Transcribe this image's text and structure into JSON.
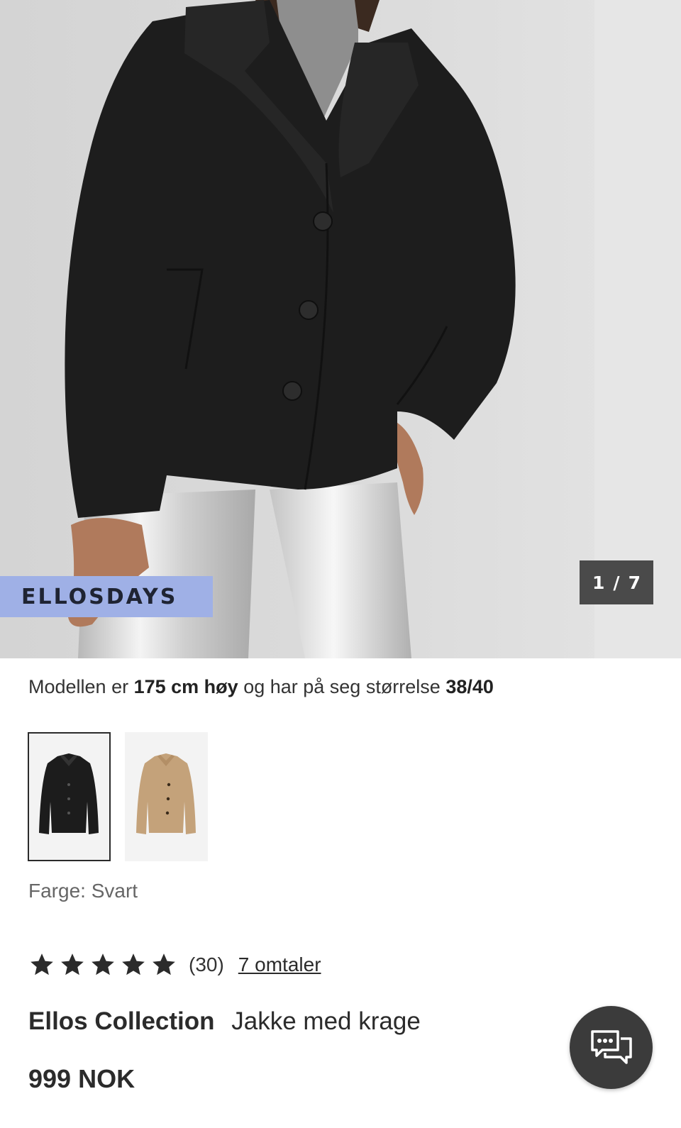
{
  "hero": {
    "badge": "ELLOSDAYS",
    "counter": {
      "current": "1",
      "separator": "/",
      "total": "7"
    }
  },
  "model_info": {
    "prefix": "Modellen er",
    "height": "175 cm høy",
    "middle": "og har på seg størrelse",
    "size": "38/40"
  },
  "swatches": [
    {
      "name": "black-coat",
      "color": "#1c1c1c",
      "selected": true
    },
    {
      "name": "beige-coat",
      "color": "#c4a27a",
      "selected": false
    }
  ],
  "color_label": "Farge: Svart",
  "rating": {
    "stars": 5,
    "count_text": "(30)",
    "reviews_link": "7 omtaler"
  },
  "product": {
    "brand": "Ellos Collection",
    "name": "Jakke med krage",
    "price": "999 NOK"
  },
  "icons": {
    "chat": "chat-bubbles-icon",
    "star": "star-icon"
  }
}
